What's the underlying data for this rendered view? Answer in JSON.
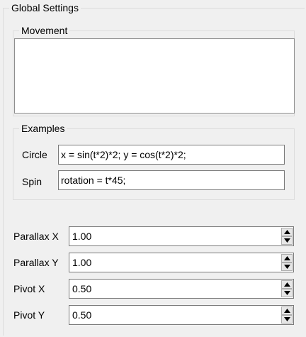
{
  "global_settings": {
    "title": "Global Settings",
    "movement": {
      "title": "Movement",
      "text": ""
    },
    "examples": {
      "title": "Examples",
      "items": [
        {
          "label": "Circle",
          "value": "x = sin(t*2)*2; y = cos(t*2)*2;"
        },
        {
          "label": "Spin",
          "value": "rotation = t*45;"
        }
      ]
    },
    "fields": [
      {
        "label": "Parallax X",
        "value": "1.00"
      },
      {
        "label": "Parallax Y",
        "value": "1.00"
      },
      {
        "label": "Pivot X",
        "value": "0.50"
      },
      {
        "label": "Pivot Y",
        "value": "0.50"
      }
    ]
  }
}
